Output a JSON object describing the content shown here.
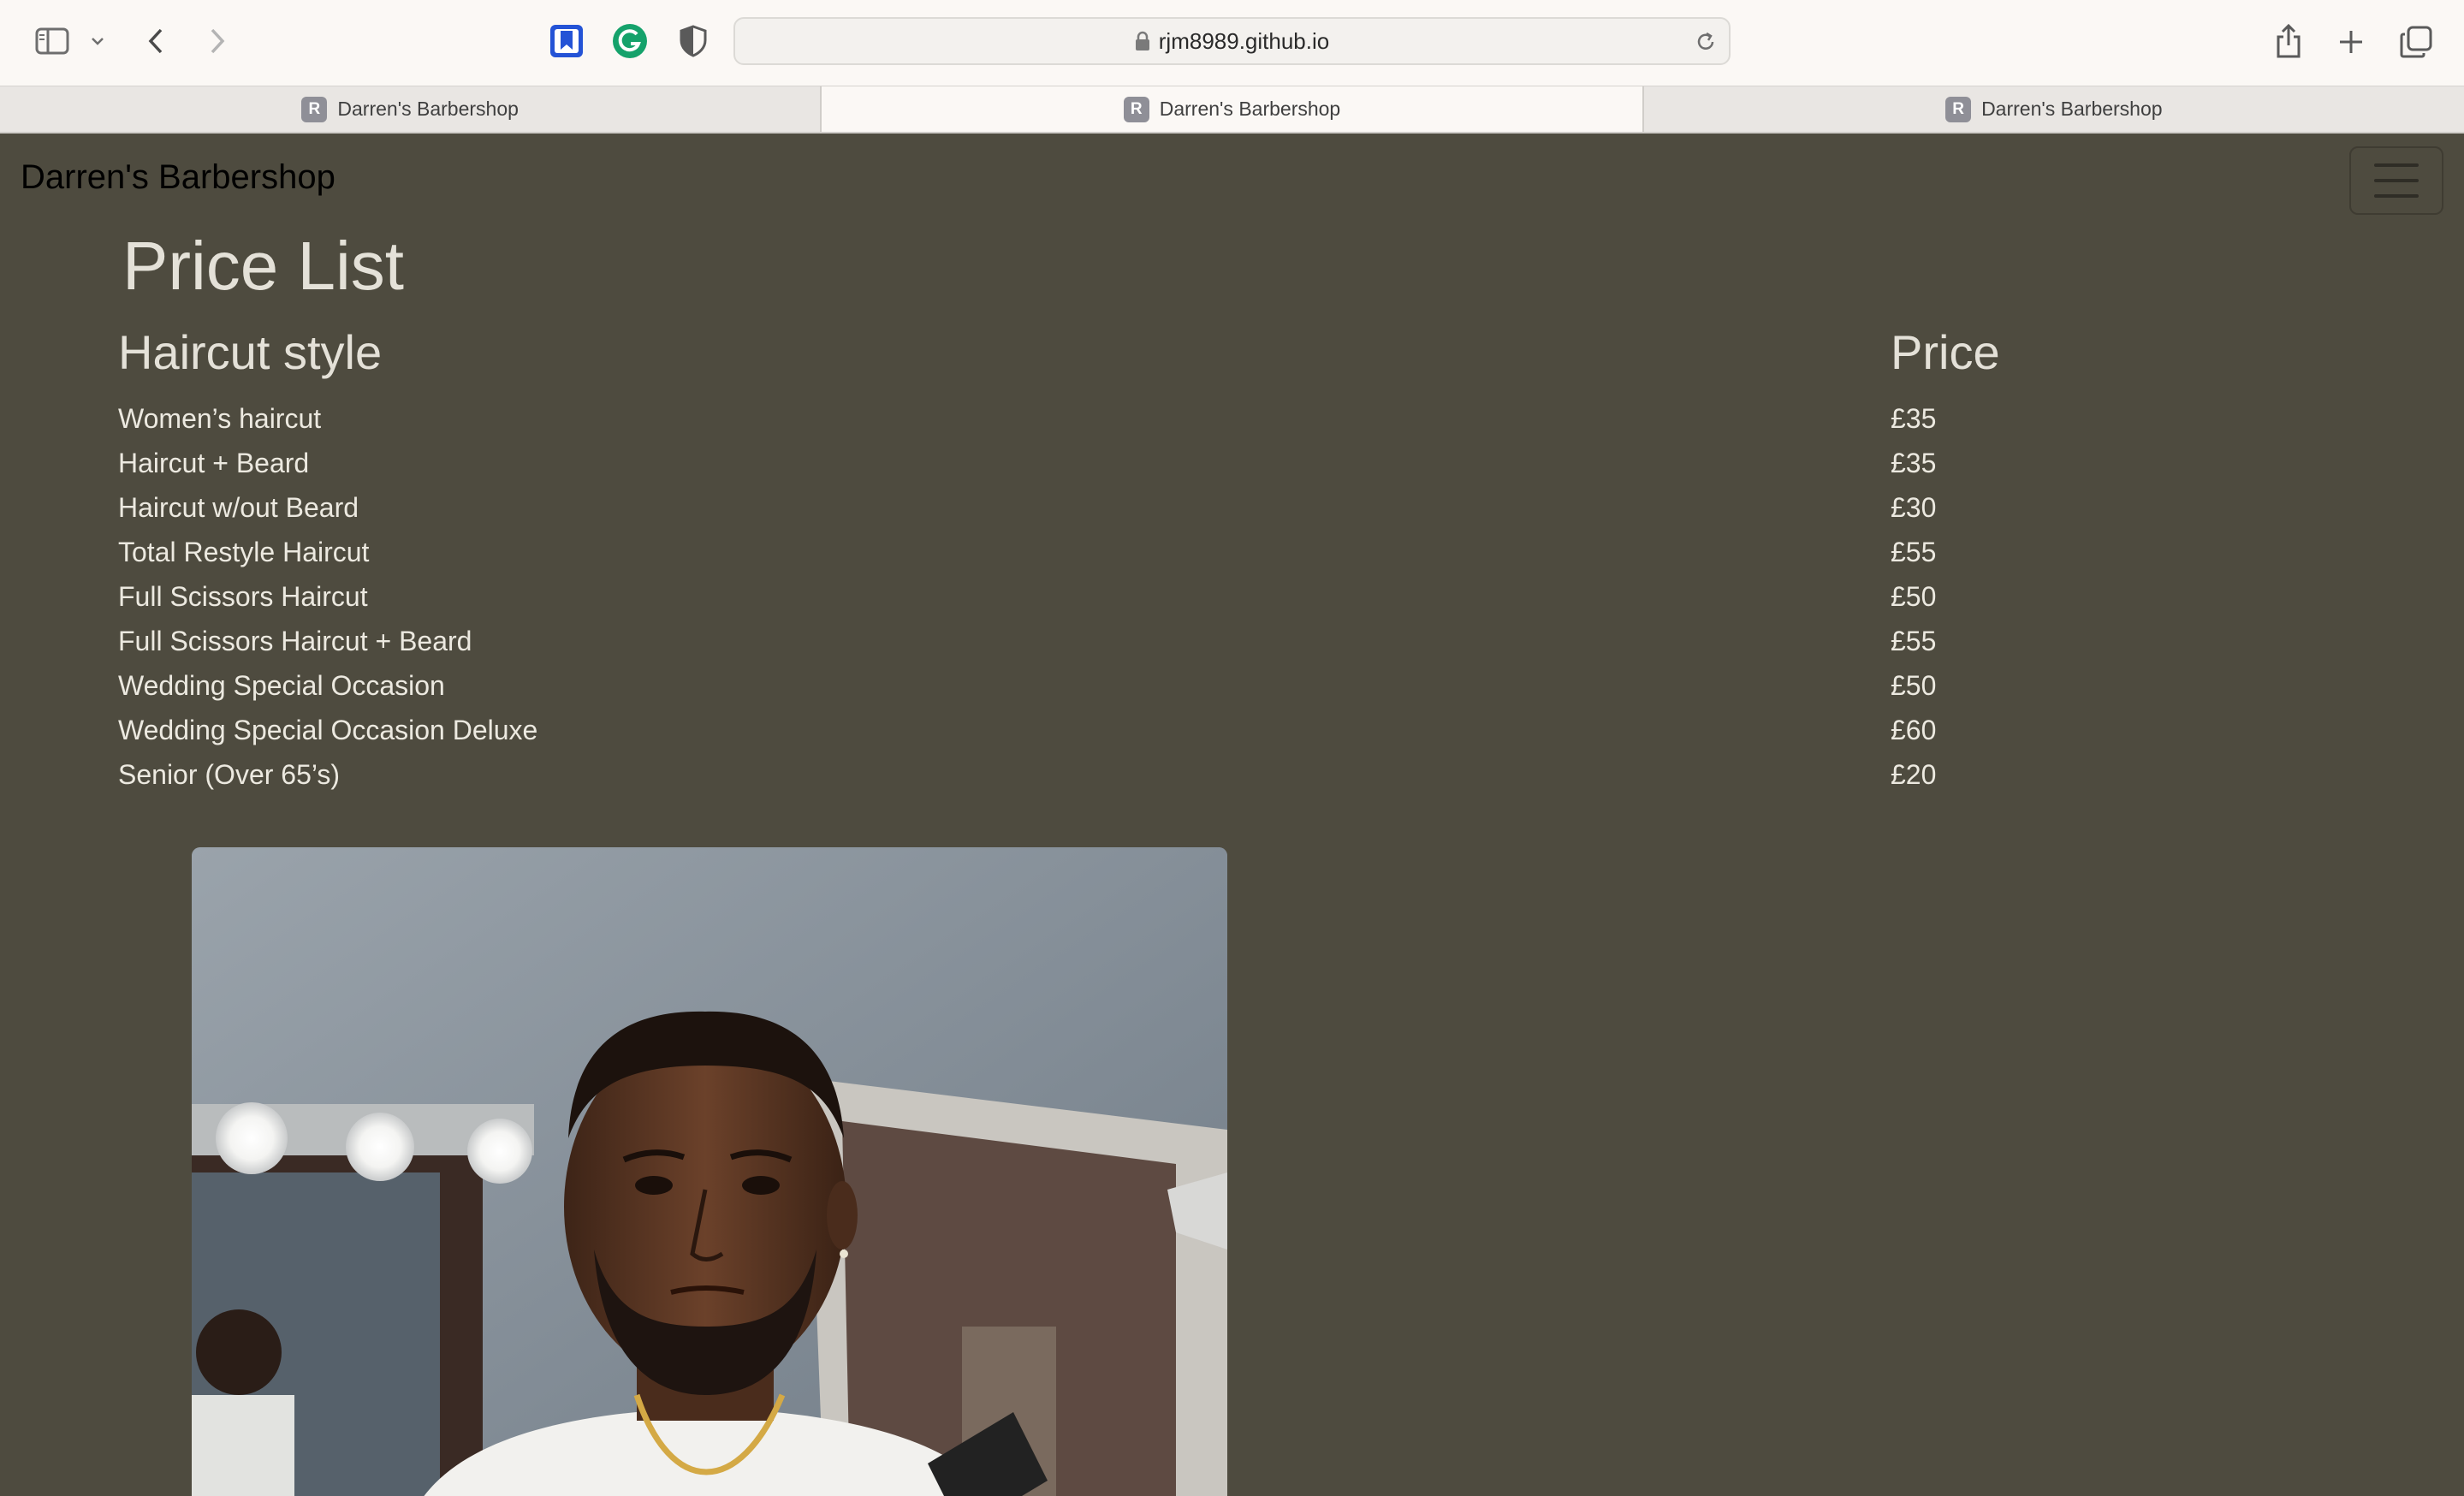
{
  "browser": {
    "url": "rjm8989.github.io",
    "tabs": [
      {
        "label": "Darren's Barbershop",
        "favicon": "R",
        "active": false
      },
      {
        "label": "Darren's Barbershop",
        "favicon": "R",
        "active": true
      },
      {
        "label": "Darren's Barbershop",
        "favicon": "R",
        "active": false
      }
    ],
    "icons": [
      "sidebar-icon",
      "chevron-down-icon",
      "back-icon",
      "forward-icon",
      "bookmark-icon",
      "grammarly-icon",
      "shield-icon",
      "reload-icon",
      "share-icon",
      "new-tab-icon",
      "tab-overview-icon"
    ]
  },
  "navbar": {
    "brand": "Darren's Barbershop",
    "menu_icon": "hamburger-icon"
  },
  "main": {
    "title": "Price List",
    "headers": {
      "style": "Haircut style",
      "price": "Price"
    },
    "rows": [
      {
        "style": "Women’s haircut",
        "price": "£35"
      },
      {
        "style": "Haircut + Beard",
        "price": "£35"
      },
      {
        "style": "Haircut w/out Beard",
        "price": "£30"
      },
      {
        "style": "Total Restyle Haircut",
        "price": "£55"
      },
      {
        "style": "Full Scissors Haircut",
        "price": "£50"
      },
      {
        "style": "Full Scissors Haircut + Beard",
        "price": "£55"
      },
      {
        "style": "Wedding Special Occasion",
        "price": "£50"
      },
      {
        "style": "Wedding Special Occasion Deluxe",
        "price": "£60"
      },
      {
        "style": "Senior (Over 65’s)",
        "price": "£20"
      }
    ]
  },
  "colors": {
    "page_background": "#4e4b3f",
    "page_text": "#e4e1d8",
    "chrome_background": "#fbf8f5"
  }
}
